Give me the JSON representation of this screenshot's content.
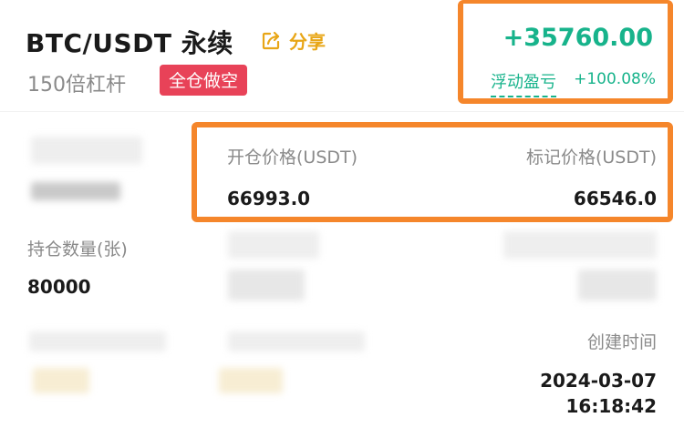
{
  "header": {
    "title": "BTC/USDT 永续",
    "share_label": "分享",
    "leverage": "150倍杠杆",
    "margin_mode_badge": "全仓做空"
  },
  "pnl": {
    "value": "+35760.00",
    "label": "浮动盈亏",
    "percent": "+100.08%"
  },
  "prices": {
    "entry_label": "开仓价格(USDT)",
    "entry_value": "66993.0",
    "mark_label": "标记价格(USDT)",
    "mark_value": "66546.0"
  },
  "position": {
    "size_label": "持仓数量(张)",
    "size_value": "80000"
  },
  "created": {
    "label": "创建时间",
    "date": "2024-03-07",
    "time": "16:18:42"
  },
  "colors": {
    "profit": "#17b38b",
    "accent_share": "#e8a617",
    "badge_short": "#e84258",
    "highlight_box": "#f5862b"
  },
  "icons": {
    "share": "share-icon"
  }
}
